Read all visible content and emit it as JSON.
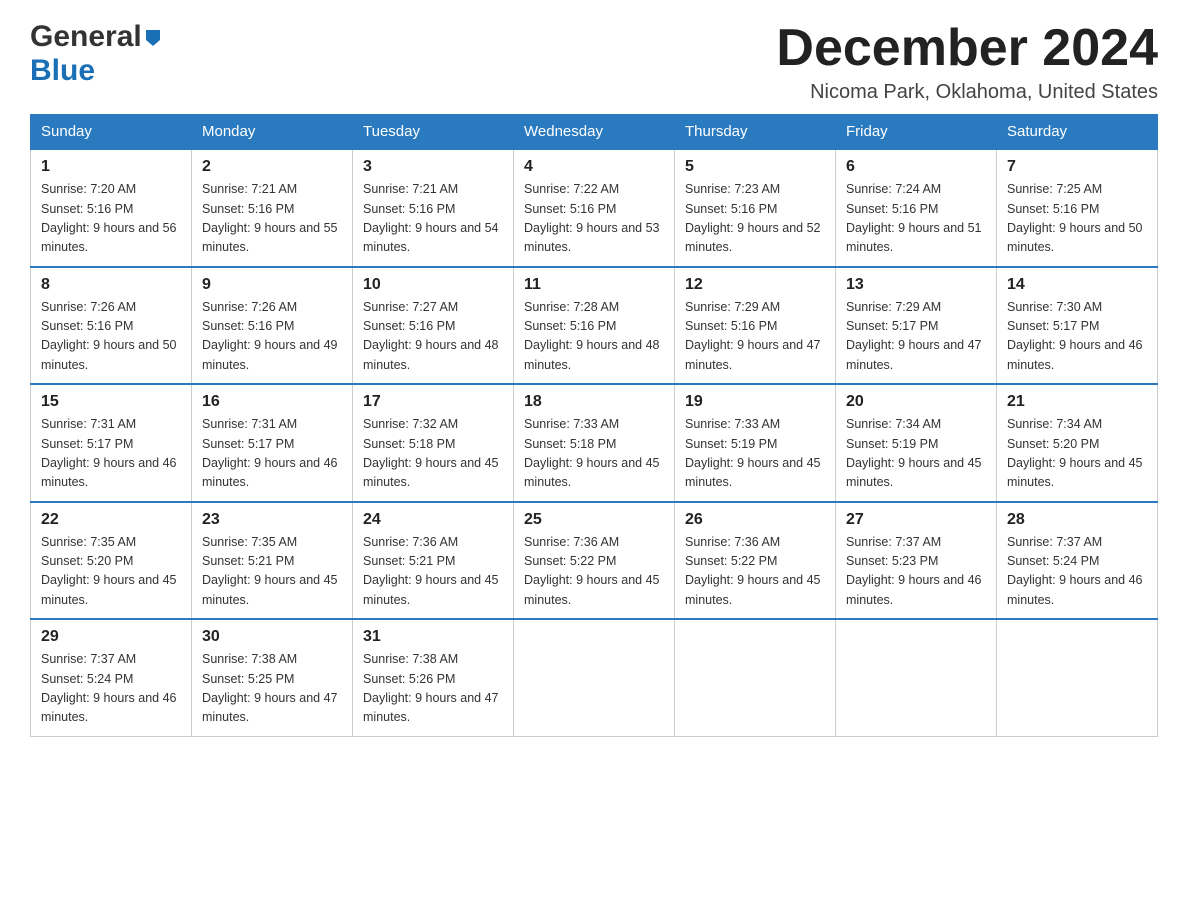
{
  "header": {
    "month_title": "December 2024",
    "location": "Nicoma Park, Oklahoma, United States",
    "logo_general": "General",
    "logo_blue": "Blue"
  },
  "days_of_week": [
    "Sunday",
    "Monday",
    "Tuesday",
    "Wednesday",
    "Thursday",
    "Friday",
    "Saturday"
  ],
  "weeks": [
    [
      {
        "day": "1",
        "sunrise": "7:20 AM",
        "sunset": "5:16 PM",
        "daylight": "9 hours and 56 minutes."
      },
      {
        "day": "2",
        "sunrise": "7:21 AM",
        "sunset": "5:16 PM",
        "daylight": "9 hours and 55 minutes."
      },
      {
        "day": "3",
        "sunrise": "7:21 AM",
        "sunset": "5:16 PM",
        "daylight": "9 hours and 54 minutes."
      },
      {
        "day": "4",
        "sunrise": "7:22 AM",
        "sunset": "5:16 PM",
        "daylight": "9 hours and 53 minutes."
      },
      {
        "day": "5",
        "sunrise": "7:23 AM",
        "sunset": "5:16 PM",
        "daylight": "9 hours and 52 minutes."
      },
      {
        "day": "6",
        "sunrise": "7:24 AM",
        "sunset": "5:16 PM",
        "daylight": "9 hours and 51 minutes."
      },
      {
        "day": "7",
        "sunrise": "7:25 AM",
        "sunset": "5:16 PM",
        "daylight": "9 hours and 50 minutes."
      }
    ],
    [
      {
        "day": "8",
        "sunrise": "7:26 AM",
        "sunset": "5:16 PM",
        "daylight": "9 hours and 50 minutes."
      },
      {
        "day": "9",
        "sunrise": "7:26 AM",
        "sunset": "5:16 PM",
        "daylight": "9 hours and 49 minutes."
      },
      {
        "day": "10",
        "sunrise": "7:27 AM",
        "sunset": "5:16 PM",
        "daylight": "9 hours and 48 minutes."
      },
      {
        "day": "11",
        "sunrise": "7:28 AM",
        "sunset": "5:16 PM",
        "daylight": "9 hours and 48 minutes."
      },
      {
        "day": "12",
        "sunrise": "7:29 AM",
        "sunset": "5:16 PM",
        "daylight": "9 hours and 47 minutes."
      },
      {
        "day": "13",
        "sunrise": "7:29 AM",
        "sunset": "5:17 PM",
        "daylight": "9 hours and 47 minutes."
      },
      {
        "day": "14",
        "sunrise": "7:30 AM",
        "sunset": "5:17 PM",
        "daylight": "9 hours and 46 minutes."
      }
    ],
    [
      {
        "day": "15",
        "sunrise": "7:31 AM",
        "sunset": "5:17 PM",
        "daylight": "9 hours and 46 minutes."
      },
      {
        "day": "16",
        "sunrise": "7:31 AM",
        "sunset": "5:17 PM",
        "daylight": "9 hours and 46 minutes."
      },
      {
        "day": "17",
        "sunrise": "7:32 AM",
        "sunset": "5:18 PM",
        "daylight": "9 hours and 45 minutes."
      },
      {
        "day": "18",
        "sunrise": "7:33 AM",
        "sunset": "5:18 PM",
        "daylight": "9 hours and 45 minutes."
      },
      {
        "day": "19",
        "sunrise": "7:33 AM",
        "sunset": "5:19 PM",
        "daylight": "9 hours and 45 minutes."
      },
      {
        "day": "20",
        "sunrise": "7:34 AM",
        "sunset": "5:19 PM",
        "daylight": "9 hours and 45 minutes."
      },
      {
        "day": "21",
        "sunrise": "7:34 AM",
        "sunset": "5:20 PM",
        "daylight": "9 hours and 45 minutes."
      }
    ],
    [
      {
        "day": "22",
        "sunrise": "7:35 AM",
        "sunset": "5:20 PM",
        "daylight": "9 hours and 45 minutes."
      },
      {
        "day": "23",
        "sunrise": "7:35 AM",
        "sunset": "5:21 PM",
        "daylight": "9 hours and 45 minutes."
      },
      {
        "day": "24",
        "sunrise": "7:36 AM",
        "sunset": "5:21 PM",
        "daylight": "9 hours and 45 minutes."
      },
      {
        "day": "25",
        "sunrise": "7:36 AM",
        "sunset": "5:22 PM",
        "daylight": "9 hours and 45 minutes."
      },
      {
        "day": "26",
        "sunrise": "7:36 AM",
        "sunset": "5:22 PM",
        "daylight": "9 hours and 45 minutes."
      },
      {
        "day": "27",
        "sunrise": "7:37 AM",
        "sunset": "5:23 PM",
        "daylight": "9 hours and 46 minutes."
      },
      {
        "day": "28",
        "sunrise": "7:37 AM",
        "sunset": "5:24 PM",
        "daylight": "9 hours and 46 minutes."
      }
    ],
    [
      {
        "day": "29",
        "sunrise": "7:37 AM",
        "sunset": "5:24 PM",
        "daylight": "9 hours and 46 minutes."
      },
      {
        "day": "30",
        "sunrise": "7:38 AM",
        "sunset": "5:25 PM",
        "daylight": "9 hours and 47 minutes."
      },
      {
        "day": "31",
        "sunrise": "7:38 AM",
        "sunset": "5:26 PM",
        "daylight": "9 hours and 47 minutes."
      },
      null,
      null,
      null,
      null
    ]
  ]
}
